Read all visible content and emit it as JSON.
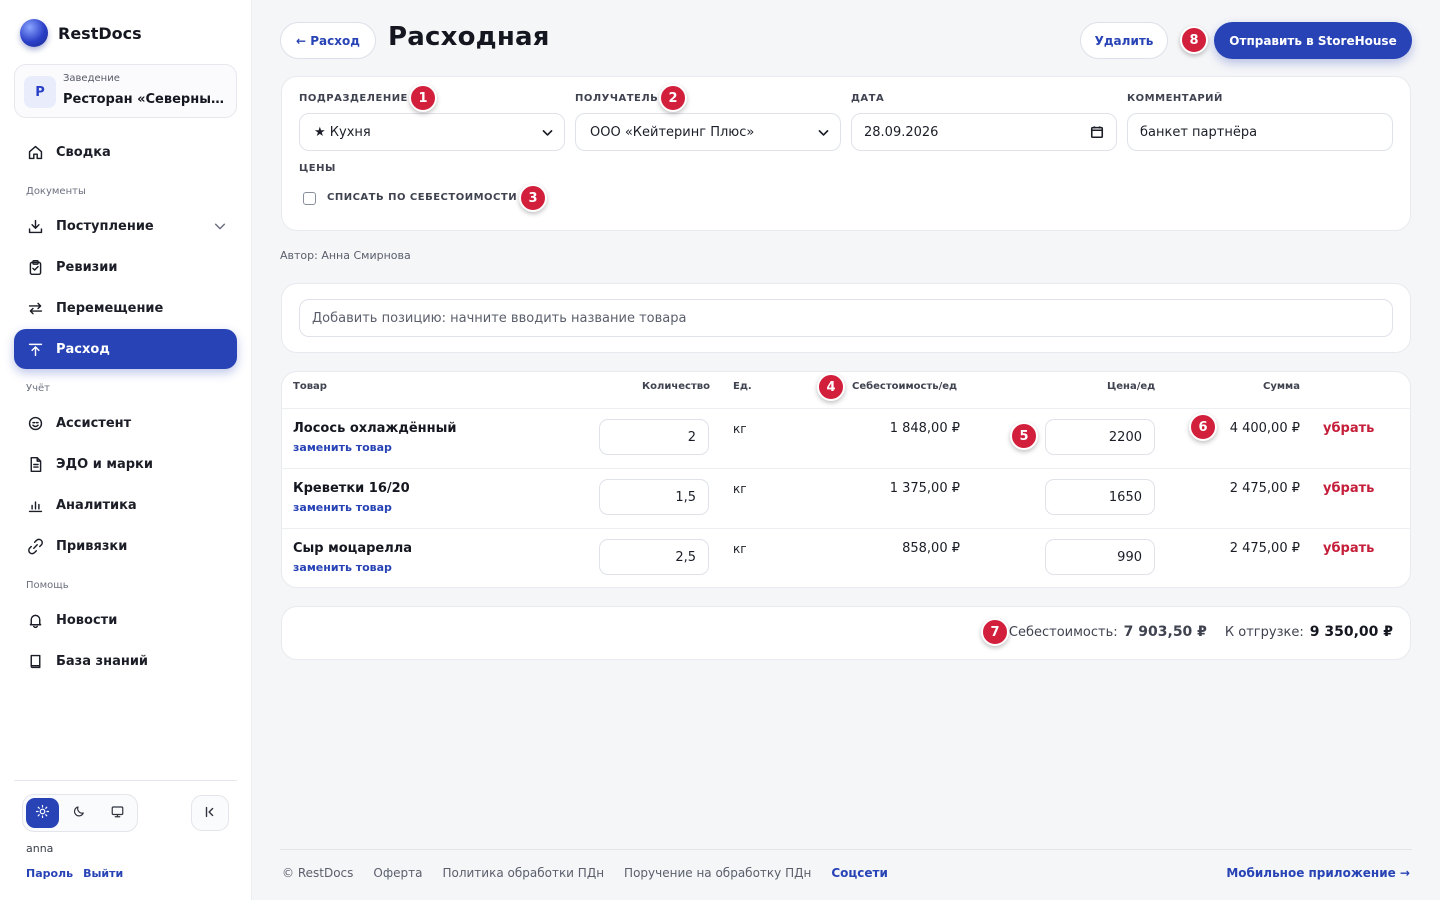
{
  "colors": {
    "accent": "#2743b5",
    "danger": "#c41e3a",
    "marker": "#d21f3c"
  },
  "sidebar": {
    "brand": "RestDocs",
    "venue": {
      "avatar": "Р",
      "label": "Заведение",
      "name": "Ресторан «Северный ветер»"
    },
    "items": [
      {
        "label": "Сводка",
        "icon": "home-icon"
      },
      {
        "label": "Поступление",
        "icon": "download-icon"
      },
      {
        "label": "Ревизии",
        "icon": "clipboard-icon"
      },
      {
        "label": "Перемещение",
        "icon": "transfer-icon"
      },
      {
        "label": "Расход",
        "icon": "upload-icon",
        "active": true
      },
      {
        "label": "Ассистент",
        "icon": "assistant-icon"
      },
      {
        "label": "ЭДО и марки",
        "icon": "document-icon"
      },
      {
        "label": "Аналитика",
        "icon": "chart-icon"
      },
      {
        "label": "Привязки",
        "icon": "link-icon"
      },
      {
        "label": "Новости",
        "icon": "bell-icon"
      },
      {
        "label": "База знаний",
        "icon": "book-icon"
      }
    ],
    "sections": {
      "documents": "Документы",
      "accounting": "Учёт",
      "help": "Помощь"
    },
    "user": {
      "name": "anna",
      "password": "Пароль",
      "logout": "Выйти"
    }
  },
  "header": {
    "back": "← Расход",
    "title": "Расходная",
    "delete": "Удалить",
    "send": "Отправить в StoreHouse"
  },
  "form": {
    "division_label": "ПОДРАЗДЕЛЕНИЕ",
    "division_value": "★ Кухня",
    "recipient_label": "ПОЛУЧАТЕЛЬ",
    "recipient_value": "ООО «Кейтеринг Плюс»",
    "date_label": "ДАТА",
    "date_value": "28.09.2026",
    "comment_label": "КОММЕНТАРИЙ",
    "comment_value": "банкет партнёра",
    "prices_label": "ЦЕНЫ",
    "writeoff_label": "СПИСАТЬ ПО СЕБЕСТОИМОСТИ"
  },
  "author": "Автор: Анна Смирнова",
  "add_item_placeholder": "Добавить позицию: начните вводить название товара",
  "table": {
    "headers": {
      "product": "Товар",
      "qty": "Количество",
      "unit": "Ед.",
      "cost": "Себестоимость/ед",
      "price": "Цена/ед",
      "sum": "Сумма"
    },
    "replace_label": "заменить товар",
    "remove_label": "убрать",
    "rows": [
      {
        "name": "Лосось охлаждённый",
        "qty": "2",
        "unit": "кг",
        "cost": "1 848,00 ₽",
        "price": "2200",
        "sum": "4 400,00 ₽"
      },
      {
        "name": "Креветки 16/20",
        "qty": "1,5",
        "unit": "кг",
        "cost": "1 375,00 ₽",
        "price": "1650",
        "sum": "2 475,00 ₽"
      },
      {
        "name": "Сыр моцарелла",
        "qty": "2,5",
        "unit": "кг",
        "cost": "858,00 ₽",
        "price": "990",
        "sum": "2 475,00 ₽"
      }
    ]
  },
  "totals": {
    "cost_label": "Себестоимость:",
    "cost_value": "7 903,50 ₽",
    "ship_label": "К отгрузке:",
    "ship_value": "9 350,00 ₽"
  },
  "footer": {
    "copyright": "© RestDocs",
    "offer": "Оферта",
    "policy": "Политика обработки ПДн",
    "instruction": "Поручение на обработку ПДн",
    "social": "Соцсети",
    "mobile": "Мобильное приложение →"
  },
  "markers": [
    "1",
    "2",
    "3",
    "4",
    "5",
    "6",
    "7",
    "8"
  ]
}
